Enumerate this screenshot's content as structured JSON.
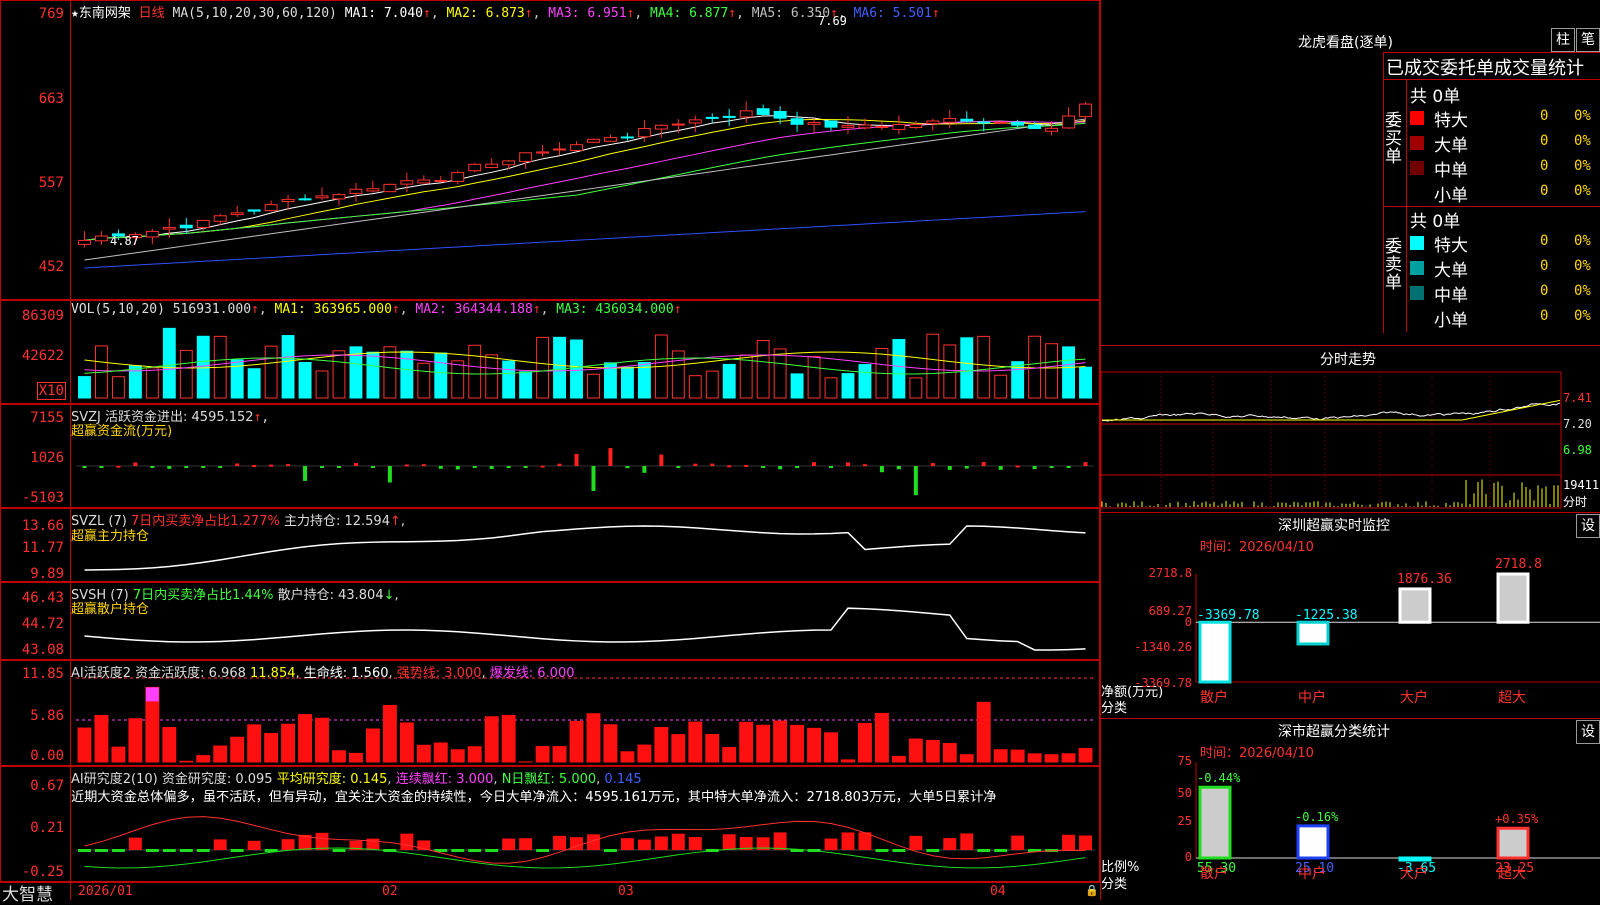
{
  "stock": {
    "name": "东南网架",
    "period": "日线"
  },
  "k_header": [
    {
      "t": "MA(5,10,20,30,60,120)",
      "c": "#dddddd"
    },
    {
      "t": "MA1: 7.040",
      "c": "#ffffff",
      "arrow": "↑"
    },
    {
      "t": "MA2: 6.873",
      "c": "#ffff00",
      "arrow": "↑"
    },
    {
      "t": "MA3: 6.951",
      "c": "#ff40ff",
      "arrow": "↑"
    },
    {
      "t": "MA4: 6.877",
      "c": "#40ff40",
      "arrow": "↑"
    },
    {
      "t": "MA5: 6.350",
      "c": "#c0c0c0",
      "arrow": "↑"
    },
    {
      "t": "MA6: 5.501",
      "c": "#4060ff",
      "arrow": "↑"
    }
  ],
  "k_axis": [
    "769",
    "663",
    "557",
    "452"
  ],
  "k_marks": {
    "high": "7.69",
    "low": "4.87"
  },
  "vol_header": [
    {
      "t": "VOL(5,10,20)",
      "c": "#dddddd"
    },
    {
      "t": "516931.000",
      "c": "#dddddd",
      "arrow": "↑"
    },
    {
      "t": "MA1: 363965.000",
      "c": "#ffff00",
      "arrow": "↑"
    },
    {
      "t": "MA2: 364344.188",
      "c": "#ff40ff",
      "arrow": "↑"
    },
    {
      "t": "MA3: 436034.000",
      "c": "#40ff40",
      "arrow": "↑"
    }
  ],
  "vol_axis": [
    "86309",
    "42622"
  ],
  "vol_unit": "X10",
  "svzj": {
    "header": "SVZJ  活跃资金进出: 4595.152",
    "arrow": "↑",
    "sub": "超赢资金流(万元)",
    "axis": [
      "7155",
      "1026",
      "-5103"
    ]
  },
  "svzl": {
    "h1": "SVZL (7)",
    "h2": "7日内买卖净占比1.277%",
    "h3": "主力持仓: 12.594",
    "arrow": "↑",
    "sub": "超赢主力持仓",
    "axis": [
      "13.66",
      "11.77",
      "9.89"
    ]
  },
  "svsh": {
    "h1": "SVSH (7)",
    "h2": "7日内买卖净占比1.44%",
    "h3": "散户持仓: 43.804",
    "arrow": "↓",
    "sub": "超赢散户持仓",
    "axis": [
      "46.43",
      "44.72",
      "43.08"
    ]
  },
  "ai1": {
    "h": [
      {
        "t": "AI活跃度2 资金活跃度: 6.968",
        "c": "#dddddd"
      },
      {
        "t": "11.854",
        "c": "#ffff00"
      },
      {
        "t": "生命线: 1.560",
        "c": "#ffffff"
      },
      {
        "t": "强势线: 3.000",
        "c": "#ff3030"
      },
      {
        "t": "爆发线: 6.000",
        "c": "#ff40ff"
      }
    ],
    "axis": [
      "11.85",
      "5.86",
      "0.00"
    ]
  },
  "ai2": {
    "h": [
      {
        "t": "AI研究度2(10) 资金研究度: 0.095",
        "c": "#dddddd"
      },
      {
        "t": "平均研究度: 0.145",
        "c": "#ffff00"
      },
      {
        "t": "连续飘红: 3.000",
        "c": "#ff40ff"
      },
      {
        "t": "N日飘红: 5.000",
        "c": "#40ff40"
      },
      {
        "t": "0.145",
        "c": "#4060ff"
      }
    ],
    "text": "近期大资金总体偏多，虽不活跃，但有异动，宜关注大资金的持续性，今日大单净流入：4595.161万元，其中特大单净流入：2718.803万元，大单5日累计净",
    "axis": [
      "0.67",
      "0.21",
      "-0.25"
    ]
  },
  "dates": [
    "2026/01",
    "02",
    "03",
    "04"
  ],
  "brand": "大智慧",
  "lh": {
    "title": "龙虎看盘(逐单)",
    "btn1": "柱",
    "btn2": "笔",
    "tabs": "已成交委托单成交量统计",
    "buy": {
      "side": "委买单",
      "count": "共 0单",
      "rows": [
        {
          "n": "特大",
          "v": "0",
          "p": "0%",
          "c": "#ff0000"
        },
        {
          "n": "大单",
          "v": "0",
          "p": "0%",
          "c": "#a00000"
        },
        {
          "n": "中单",
          "v": "0",
          "p": "0%",
          "c": "#700000"
        },
        {
          "n": "小单",
          "v": "0",
          "p": "0%",
          "c": "#000000"
        }
      ]
    },
    "sell": {
      "side": "委卖单",
      "count": "共 0单",
      "rows": [
        {
          "n": "特大",
          "v": "0",
          "p": "0%",
          "c": "#00ffff"
        },
        {
          "n": "大单",
          "v": "0",
          "p": "0%",
          "c": "#00a0a0"
        },
        {
          "n": "中单",
          "v": "0",
          "p": "0%",
          "c": "#007070"
        },
        {
          "n": "小单",
          "v": "0",
          "p": "0%",
          "c": "#000000"
        }
      ]
    }
  },
  "fs": {
    "title": "分时走势",
    "axis": [
      "7.41",
      "7.20",
      "6.98"
    ],
    "vol": "19411",
    "unit": "分时"
  },
  "sz1": {
    "title": "深圳超赢实时监控",
    "btn": "设",
    "time": "时间：2026/04/10",
    "axis": [
      "2718.8",
      "689.27",
      "0",
      "-1340.26",
      "-3369.78"
    ],
    "ylabel1": "净额(万元)",
    "ylabel2": "分类",
    "chart_data": {
      "type": "bar",
      "categories": [
        "散户",
        "中户",
        "大户",
        "超大"
      ],
      "values": [
        -3369.78,
        -1225.38,
        1876.36,
        2718.8
      ],
      "ylim": [
        -3369.78,
        2718.8
      ]
    },
    "labels": [
      "-3369.78",
      "-1225.38",
      "1876.36",
      "2718.8"
    ]
  },
  "sz2": {
    "title": "深市超赢分类统计",
    "btn": "设",
    "time": "时间：2026/04/10",
    "axis": [
      "75",
      "50",
      "25",
      "0"
    ],
    "ylabel1": "比例%",
    "ylabel2": "分类",
    "chart_data": {
      "type": "bar",
      "categories": [
        "散户",
        "中户",
        "大户",
        "超大"
      ],
      "values": [
        55.3,
        25.1,
        -3.65,
        23.25
      ],
      "changes": [
        "-0.44%",
        "-0.16%",
        "",
        "+0.35%"
      ],
      "ylim": [
        0,
        75
      ]
    },
    "vals": [
      "55.30",
      "25.10",
      "-3.65",
      "23.25"
    ]
  }
}
